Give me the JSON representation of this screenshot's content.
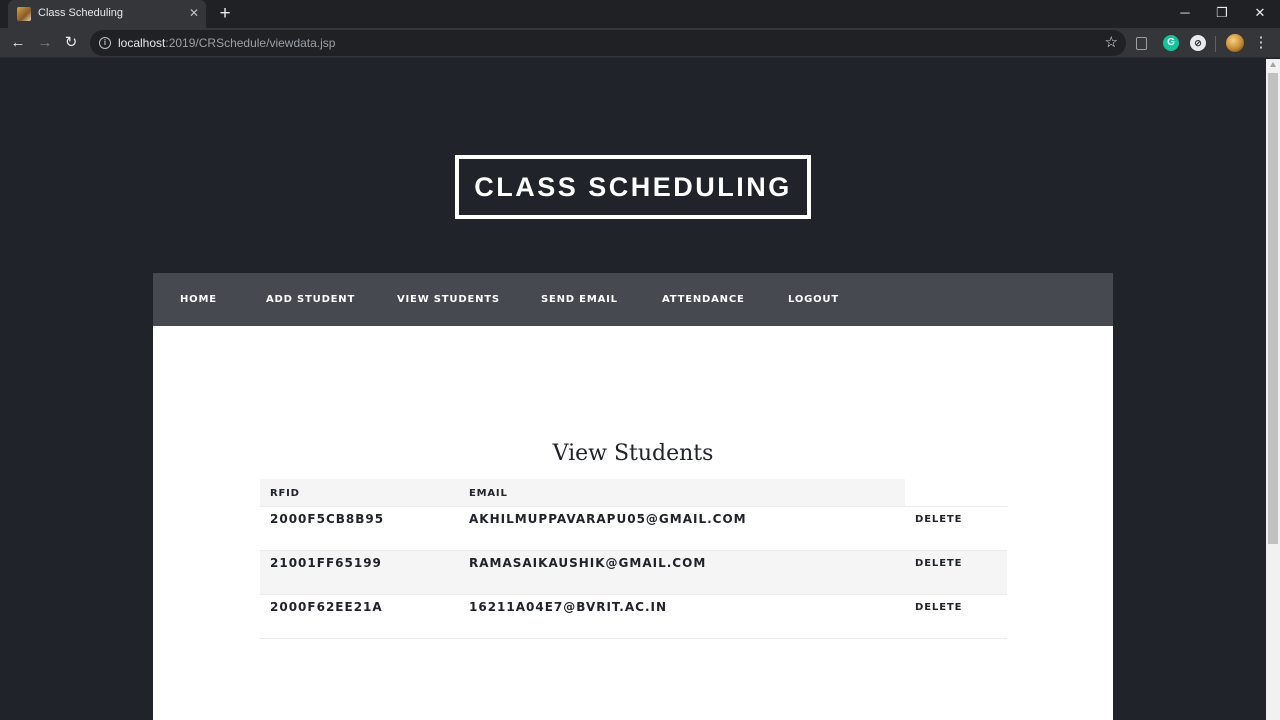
{
  "browser": {
    "tab_title": "Class Scheduling",
    "tab_close": "✕",
    "new_tab": "+",
    "url_host": "localhost",
    "url_path": ":2019/CRSchedule/viewdata.jsp",
    "window_controls": {
      "minimize": "─",
      "maximize": "❐",
      "close": "✕"
    },
    "toolbar_icons": {
      "back": "←",
      "forward": "→",
      "reload": "↻",
      "star": "☆",
      "menu": "⋮",
      "grammarly": "G",
      "ext3": "⊘"
    }
  },
  "site": {
    "title": "CLASS SCHEDULING",
    "nav": [
      "HOME",
      "ADD STUDENT",
      "VIEW STUDENTS",
      "SEND EMAIL",
      "ATTENDANCE",
      "LOGOUT"
    ]
  },
  "main": {
    "heading": "View Students",
    "table": {
      "headers": [
        "RFID",
        "EMAIL"
      ],
      "action_label": "DELETE",
      "rows": [
        {
          "rfid": "2000F5CB8B95",
          "email": "AKHILMUPPAVARAPU05@GMAIL.COM"
        },
        {
          "rfid": "21001FF65199",
          "email": "RAMASAIKAUSHIK@GMAIL.COM"
        },
        {
          "rfid": "2000F62EE21A",
          "email": "16211A04E7@BVRIT.AC.IN"
        }
      ]
    }
  },
  "colors": {
    "page_bg": "#202329",
    "nav_bg": "#464950",
    "content_bg": "#ffffff",
    "row_alt": "#f5f5f5",
    "text": "#202329"
  }
}
